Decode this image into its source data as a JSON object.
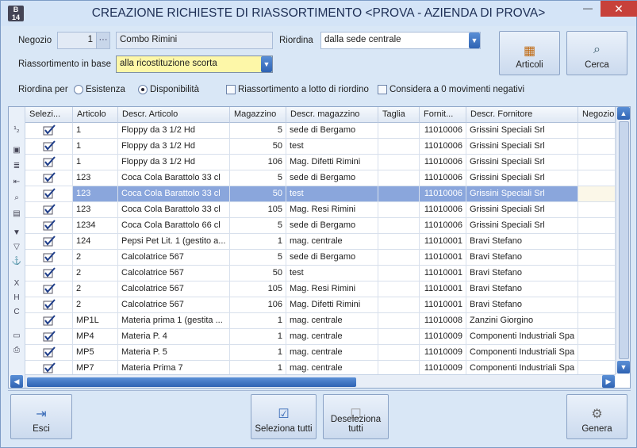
{
  "window": {
    "title": "CREAZIONE RICHIESTE DI RIASSORTIMENTO <PROVA - AZIENDA DI PROVA>",
    "app_icon_text": "B\n14",
    "close": "✕",
    "minimize": "—"
  },
  "form": {
    "negozio_label": "Negozio",
    "negozio_code": "1",
    "negozio_name": "Combo Rimini",
    "riordina_label": "Riordina",
    "riordina_value": "dalla sede centrale",
    "riass_label": "Riassortimento in base",
    "riass_value": "alla ricostituzione scorta",
    "riordina_per_label": "Riordina per",
    "opt_esistenza": "Esistenza",
    "opt_disponibilita": "Disponibilità",
    "chk_lotto": "Riassortimento a lotto di riordino",
    "chk_negativi": "Considera a 0 movimenti negativi"
  },
  "buttons": {
    "articoli": "Articoli",
    "cerca": "Cerca",
    "esci": "Esci",
    "seleziona_tutti": "Seleziona tutti",
    "deseleziona_tutti": "Deseleziona tutti",
    "genera": "Genera"
  },
  "grid": {
    "headers": [
      "Selezi...",
      "Articolo",
      "Descr. Articolo",
      "Magazzino",
      "Descr. magazzino",
      "Taglia",
      "Fornit...",
      "Descr. Fornitore",
      "Negozio"
    ],
    "rows": [
      [
        "1",
        "Floppy da 3 1/2 Hd",
        "5",
        "sede di Bergamo",
        "",
        "11010006",
        "Grissini Speciali Srl"
      ],
      [
        "1",
        "Floppy da 3 1/2 Hd",
        "50",
        "test",
        "",
        "11010006",
        "Grissini Speciali Srl"
      ],
      [
        "1",
        "Floppy da 3 1/2 Hd",
        "106",
        "Mag. Difetti Rimini",
        "",
        "11010006",
        "Grissini Speciali Srl"
      ],
      [
        "123",
        "Coca Cola Barattolo 33 cl",
        "5",
        "sede di Bergamo",
        "",
        "11010006",
        "Grissini Speciali Srl"
      ],
      [
        "123",
        "Coca Cola Barattolo 33 cl",
        "50",
        "test",
        "",
        "11010006",
        "Grissini Speciali Srl"
      ],
      [
        "123",
        "Coca Cola Barattolo 33 cl",
        "105",
        "Mag. Resi Rimini",
        "",
        "11010006",
        "Grissini Speciali Srl"
      ],
      [
        "1234",
        "Coca Cola Barattolo 66 cl",
        "5",
        "sede di Bergamo",
        "",
        "11010006",
        "Grissini Speciali Srl"
      ],
      [
        "124",
        "Pepsi Pet Lit. 1 (gestito a...",
        "1",
        "mag. centrale",
        "",
        "11010001",
        "Bravi Stefano"
      ],
      [
        "2",
        "Calcolatrice 567",
        "5",
        "sede di Bergamo",
        "",
        "11010001",
        "Bravi Stefano"
      ],
      [
        "2",
        "Calcolatrice 567",
        "50",
        "test",
        "",
        "11010001",
        "Bravi Stefano"
      ],
      [
        "2",
        "Calcolatrice 567",
        "105",
        "Mag. Resi Rimini",
        "",
        "11010001",
        "Bravi Stefano"
      ],
      [
        "2",
        "Calcolatrice 567",
        "106",
        "Mag. Difetti Rimini",
        "",
        "11010001",
        "Bravi Stefano"
      ],
      [
        "MP1L",
        "Materia prima  1 (gestita ...",
        "1",
        "mag. centrale",
        "",
        "11010008",
        "Zanzini Giorgino"
      ],
      [
        "MP4",
        "Materia P. 4",
        "1",
        "mag. centrale",
        "",
        "11010009",
        "Componenti Industriali Spa"
      ],
      [
        "MP5",
        "Materia P. 5",
        "1",
        "mag. centrale",
        "",
        "11010009",
        "Componenti Industriali Spa"
      ],
      [
        "MP7",
        "Materia Prima 7",
        "1",
        "mag. centrale",
        "",
        "11010009",
        "Componenti Industriali Spa"
      ]
    ],
    "selected_row": 4
  },
  "colors": {
    "accent": "#2f63b3",
    "selected_row": "#8aa6dc",
    "yellow_field": "#fdf7a8",
    "close_red": "#c7413a"
  }
}
